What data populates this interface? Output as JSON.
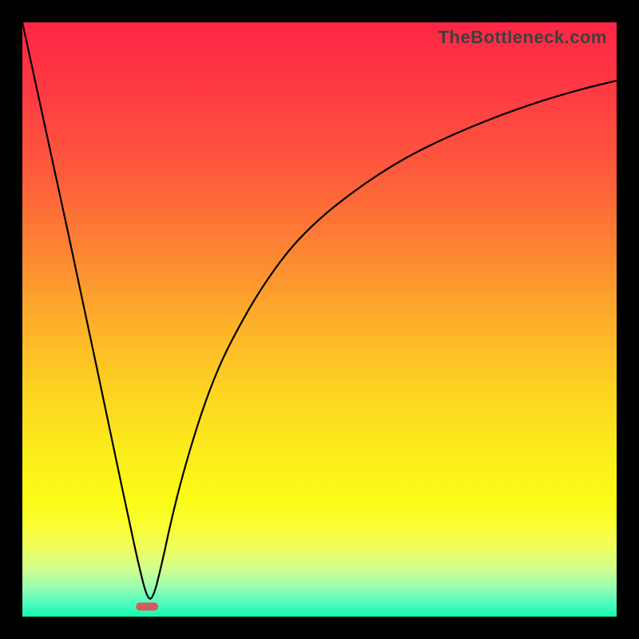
{
  "watermark": "TheBottleneck.com",
  "chart_data": {
    "type": "line",
    "x_range": [
      0,
      100
    ],
    "y_range_percent_from_top": [
      0,
      100
    ],
    "note": "Y is plotted as percent from top (0 = top red, 100 = bottom green). The curve shows a bottleneck metric; minimum (best) is near x≈21.",
    "series": [
      {
        "name": "bottleneck-curve",
        "x": [
          0,
          5,
          10,
          15,
          18,
          19.5,
          21,
          22,
          23.5,
          25,
          27,
          30,
          33,
          36,
          40,
          45,
          50,
          55,
          60,
          65,
          70,
          75,
          80,
          85,
          90,
          95,
          100
        ],
        "y": [
          0,
          23,
          46,
          70,
          84,
          91,
          97,
          97,
          91,
          84,
          76,
          66,
          58,
          52,
          45,
          38,
          33,
          29,
          25.5,
          22.5,
          20,
          17.8,
          15.8,
          14,
          12.4,
          11,
          9.8
        ]
      }
    ],
    "marker": {
      "name": "optimal-point",
      "x": 21,
      "y_percent_from_top": 98.3,
      "color": "#d65a5a"
    },
    "gradient_stops": [
      {
        "offset": 0,
        "color": "#fe2645"
      },
      {
        "offset": 12,
        "color": "#fe3b42"
      },
      {
        "offset": 25,
        "color": "#fd5a3c"
      },
      {
        "offset": 38,
        "color": "#fd8333"
      },
      {
        "offset": 50,
        "color": "#fdae2a"
      },
      {
        "offset": 62,
        "color": "#fdd321"
      },
      {
        "offset": 72,
        "color": "#fcec1b"
      },
      {
        "offset": 80,
        "color": "#fbfb16"
      },
      {
        "offset": 84,
        "color": "#fafe2d"
      },
      {
        "offset": 88,
        "color": "#f1fe58"
      },
      {
        "offset": 92,
        "color": "#d0fe8e"
      },
      {
        "offset": 95,
        "color": "#9afdb0"
      },
      {
        "offset": 97.5,
        "color": "#54fbbf"
      },
      {
        "offset": 100,
        "color": "#15f9b0"
      }
    ]
  }
}
